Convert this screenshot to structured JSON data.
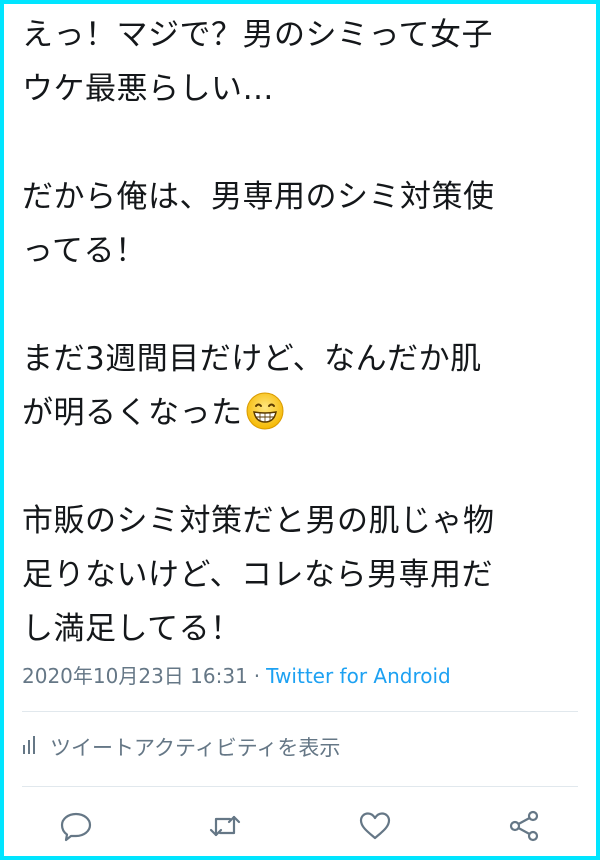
{
  "tweet": {
    "paragraphs": [
      [
        "えっ！マジで？男のシミって女子",
        "ウケ最悪らしい…"
      ],
      [
        "だから俺は、男専用のシミ対策使",
        "ってる！"
      ],
      [
        "まだ3週間目だけど、なんだか肌",
        "が明るくなった"
      ],
      [
        "市販のシミ対策だと男の肌じゃ物",
        "足りないけど、コレなら男専用だ",
        "し満足してる！"
      ]
    ],
    "emoji": "grinning-face-with-smiling-eyes",
    "timestamp": "2020年10月23日 16:31",
    "separator": "·",
    "source": "Twitter for Android"
  },
  "activity": {
    "label": "ツイートアクティビティを表示"
  },
  "actions": {
    "icons": [
      "reply-icon",
      "retweet-icon",
      "like-icon",
      "share-icon"
    ]
  },
  "colors": {
    "frame": "#00e5ff",
    "text": "#14171a",
    "muted": "#657786",
    "link": "#1da1f2",
    "divider": "#e1e8ed"
  }
}
